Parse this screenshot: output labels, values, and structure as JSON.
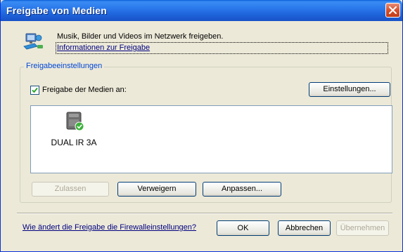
{
  "window": {
    "title": "Freigabe von Medien",
    "title_bar_color": "#1e63d9",
    "close_icon": "close-icon"
  },
  "header": {
    "icon": "network-media-icon",
    "description": "Musik, Bilder und Videos im Netzwerk freigeben.",
    "info_link": "Informationen zur Freigabe"
  },
  "settings_group": {
    "legend": "Freigabeeinstellungen",
    "share_checkbox": {
      "label": "Freigabe der Medien an:",
      "checked": true
    },
    "settings_button": "Einstellungen..."
  },
  "devices": [
    {
      "name": "DUAL IR 3A",
      "icon": "media-device-allowed-icon",
      "status": "allowed"
    }
  ],
  "device_actions": {
    "allow": {
      "label": "Zulassen",
      "enabled": false
    },
    "deny": {
      "label": "Verweigern",
      "enabled": true
    },
    "customize": {
      "label": "Anpassen...",
      "enabled": true
    }
  },
  "footer": {
    "firewall_link": "Wie ändert die Freigabe die Firewalleinstellungen?",
    "ok": {
      "label": "OK",
      "enabled": true
    },
    "cancel": {
      "label": "Abbrechen",
      "enabled": true
    },
    "apply": {
      "label": "Übernehmen",
      "enabled": false
    }
  },
  "colors": {
    "dialog_bg": "#ece9d8",
    "accent": "#0046d5",
    "link": "#000080",
    "status_ok": "#3cb13c"
  }
}
